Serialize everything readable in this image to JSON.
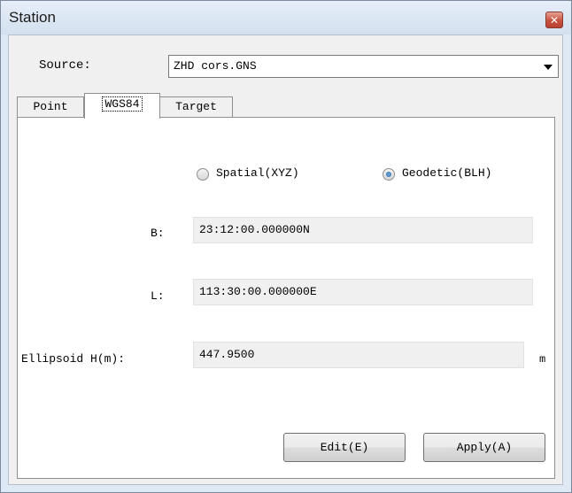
{
  "window": {
    "title": "Station",
    "close_icon": "close-icon"
  },
  "source": {
    "label": "Source:",
    "selected": "ZHD cors.GNS"
  },
  "tabs": [
    {
      "label": "Point",
      "active": false
    },
    {
      "label": "WGS84",
      "active": true
    },
    {
      "label": "Target",
      "active": false
    }
  ],
  "coordinate_mode": {
    "options": [
      {
        "label": "Spatial(XYZ)",
        "checked": false
      },
      {
        "label": "Geodetic(BLH)",
        "checked": true
      }
    ]
  },
  "fields": {
    "b": {
      "label": "B:",
      "value": "23:12:00.000000N"
    },
    "l": {
      "label": "L:",
      "value": "113:30:00.000000E"
    },
    "h": {
      "label": "Ellipsoid H(m):",
      "value": "447.9500",
      "unit": "m"
    }
  },
  "buttons": {
    "edit": "Edit(E)",
    "apply": "Apply(A)"
  },
  "colors": {
    "title_bar": "#dbe6f3",
    "close_button": "#c7523f",
    "radio_selected": "#1c5a9a"
  }
}
